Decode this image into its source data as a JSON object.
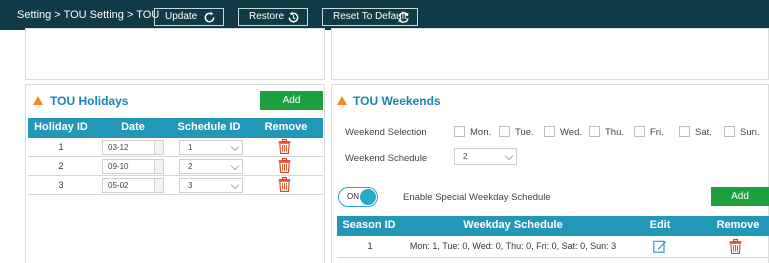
{
  "header": {
    "breadcrumb": "Setting > TOU Setting > TOU",
    "buttons": [
      {
        "label": "Update",
        "icon": "refresh-icon"
      },
      {
        "label": "Restore",
        "icon": "restore-icon"
      },
      {
        "label": "Reset To Default",
        "icon": "reset-icon"
      }
    ]
  },
  "holidays": {
    "title": "TOU Holidays",
    "add_label": "Add",
    "columns": [
      "Holiday ID",
      "Date",
      "Schedule ID",
      "Remove"
    ],
    "rows": [
      {
        "id": "1",
        "date": "03-12",
        "schedule": "1"
      },
      {
        "id": "2",
        "date": "09-10",
        "schedule": "2"
      },
      {
        "id": "3",
        "date": "05-02",
        "schedule": "3"
      }
    ]
  },
  "weekends": {
    "title": "TOU Weekends",
    "selection_label": "Weekend Selection",
    "days": [
      "Mon.",
      "Tue.",
      "Wed.",
      "Thu.",
      "Fri.",
      "Sat.",
      "Sun."
    ],
    "schedule_label": "Weekend Schedule",
    "schedule_value": "2",
    "toggle_label": "ON",
    "special_label": "Enable Special Weekday Schedule",
    "add_label": "Add",
    "columns": [
      "Season ID",
      "Weekday Schedule",
      "Edit",
      "Remove"
    ],
    "rows": [
      {
        "id": "1",
        "schedule": "Mon: 1, Tue: 0, Wed: 0, Thu: 0, Fri: 0, Sat: 0, Sun: 3"
      }
    ]
  },
  "colors": {
    "header_bg": "#103a45",
    "table_header": "#2297b6",
    "add_button": "#1ea03f",
    "section_title": "#1a86ad",
    "accent_triangle": "#f08c1e",
    "delete_icon": "#d9441c"
  }
}
